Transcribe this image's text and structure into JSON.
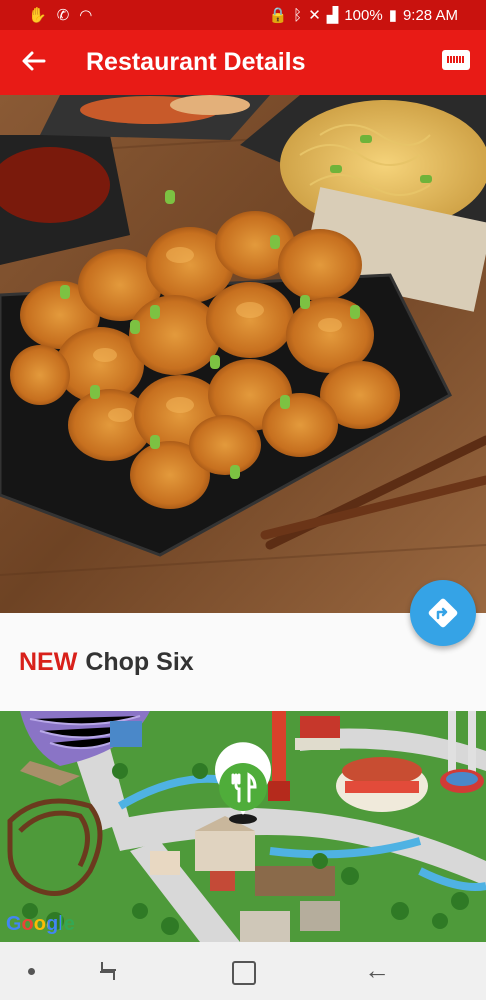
{
  "status_bar": {
    "battery": "100%",
    "time": "9:28 AM"
  },
  "app_bar": {
    "title": "Restaurant Details"
  },
  "restaurant": {
    "badge": "NEW",
    "name": "Chop Six"
  },
  "map": {
    "attribution": "Google"
  },
  "colors": {
    "status_bar": "#c9120e",
    "app_bar": "#e81b16",
    "accent_new": "#d8201a",
    "fab": "#35a3e6",
    "map_pin": "#4fad3a"
  }
}
